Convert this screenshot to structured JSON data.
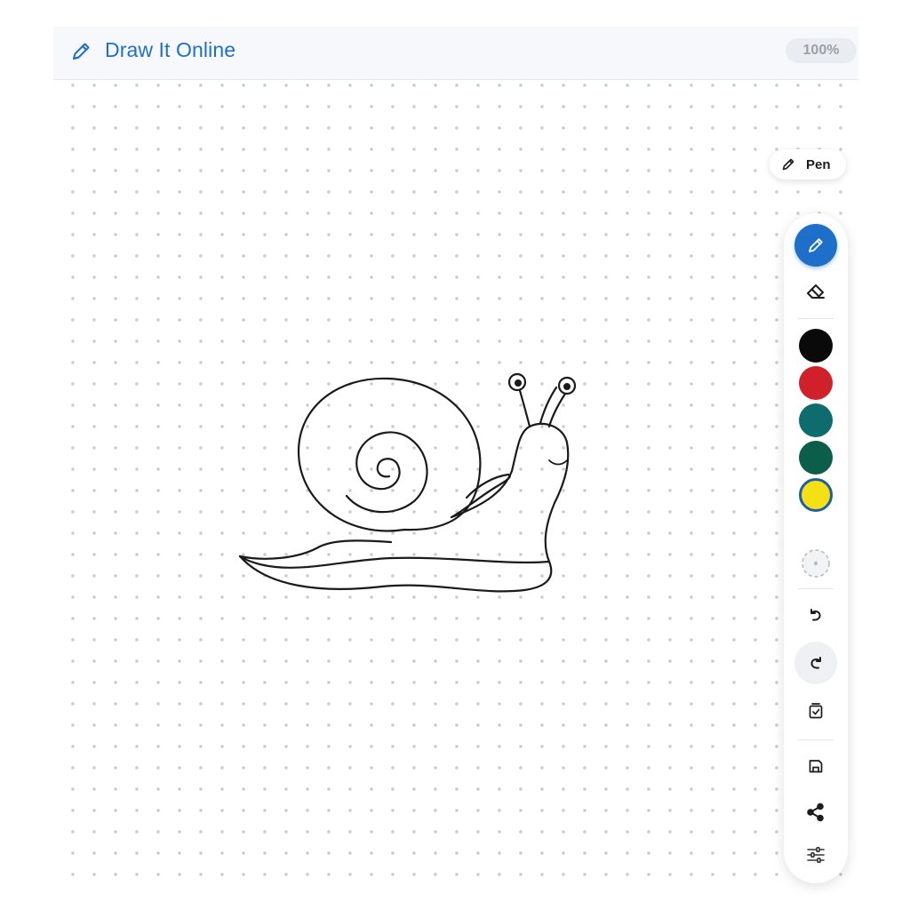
{
  "header": {
    "title": "Draw It Online",
    "zoom": "100%"
  },
  "tool_indicator": {
    "label": "Pen",
    "icon": "pencil-icon"
  },
  "toolbar": {
    "tools": [
      {
        "name": "pen",
        "icon": "pencil-icon",
        "active": true
      },
      {
        "name": "eraser",
        "icon": "eraser-icon",
        "active": false
      }
    ],
    "colors": [
      {
        "name": "black",
        "hex": "#0a0a0a",
        "selected": false
      },
      {
        "name": "red",
        "hex": "#d0202a",
        "selected": false
      },
      {
        "name": "teal",
        "hex": "#0e6b6e",
        "selected": false
      },
      {
        "name": "green",
        "hex": "#0b5e4a",
        "selected": false
      },
      {
        "name": "yellow",
        "hex": "#f5e015",
        "selected": true
      }
    ],
    "actions": [
      {
        "name": "brush-size",
        "icon": "brush-size-icon"
      },
      {
        "name": "undo",
        "icon": "undo-icon"
      },
      {
        "name": "redo",
        "icon": "redo-icon"
      },
      {
        "name": "clear",
        "icon": "clear-canvas-icon"
      },
      {
        "name": "save",
        "icon": "save-icon"
      },
      {
        "name": "share",
        "icon": "share-icon"
      },
      {
        "name": "settings",
        "icon": "settings-sliders-icon"
      }
    ]
  },
  "colors": {
    "accent": "#1e6fc9",
    "header_bg": "#f6f8fb",
    "stroke": "#1a1a1a"
  }
}
